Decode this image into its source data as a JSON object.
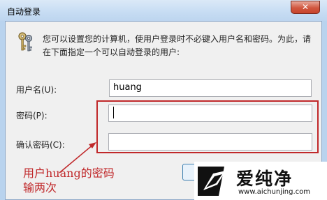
{
  "window": {
    "title": "自动登录",
    "close_glyph": "✕",
    "description": "您可以设置您的计算机，使用户登录时不必键入用户名和密码。为此，请在下面指定一个可以自动登录的用户:"
  },
  "form": {
    "username_label": "用户名(U):",
    "username_value": "huang",
    "password_label": "密码(P):",
    "password_value": "",
    "confirm_label": "确认密码(C):",
    "confirm_value": ""
  },
  "annotation": {
    "text": "用户huang的密码\n输两次",
    "color": "#c0282a"
  },
  "watermark": {
    "brand": "爱纯净",
    "url": "www.aichunjing.com"
  },
  "icons": [
    "keys-icon",
    "close-icon",
    "arrow-annotation",
    "watermark-logo"
  ]
}
